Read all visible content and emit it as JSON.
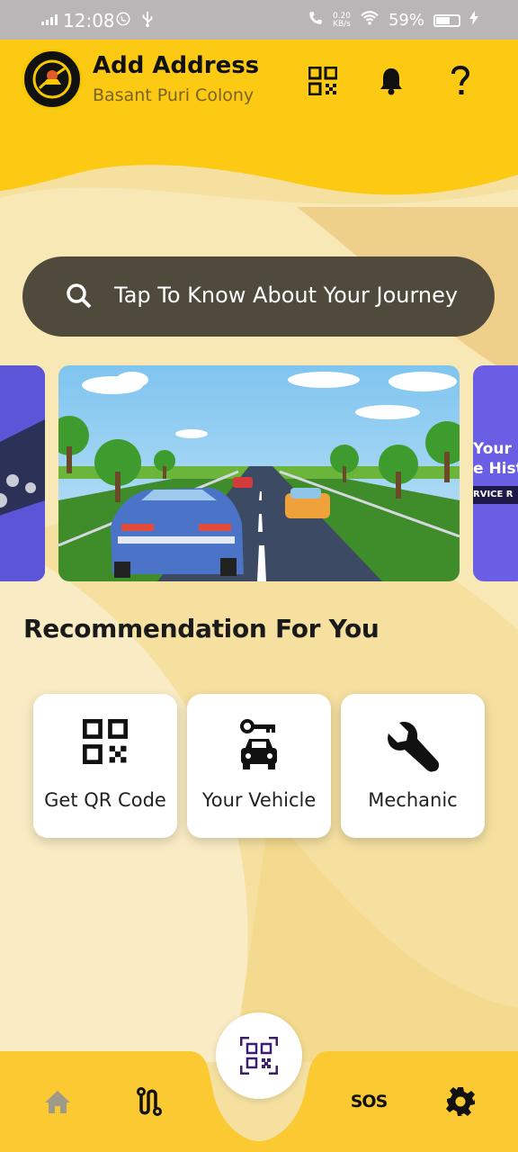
{
  "status_bar": {
    "time": "12:08",
    "speed_value": "0.20",
    "speed_unit": "KB/s",
    "battery": "59%"
  },
  "header": {
    "title": "Add Address",
    "subtitle": "Basant Puri Colony"
  },
  "search": {
    "placeholder": "Tap To Know About Your Journey"
  },
  "carousel": {
    "right_banner_lines": [
      "Your",
      "e Hist",
      "RVICE R"
    ]
  },
  "recommendations": {
    "title": "Recommendation For You",
    "cards": [
      {
        "label": "Get QR Code",
        "icon": "qr-code-icon"
      },
      {
        "label": "Your Vehicle",
        "icon": "car-key-icon"
      },
      {
        "label": "Mechanic",
        "icon": "wrench-icon"
      }
    ]
  },
  "bottom_nav": {
    "sos_label": "SOS",
    "items": [
      "home-icon",
      "route-icon",
      "qr-scan-icon",
      "sos-icon",
      "gear-icon"
    ]
  },
  "colors": {
    "header_yellow": "#fcc913",
    "search_bg": "#4f4a3c",
    "nav_yellow": "#fbc932",
    "fab_icon": "#3c1e6e"
  }
}
